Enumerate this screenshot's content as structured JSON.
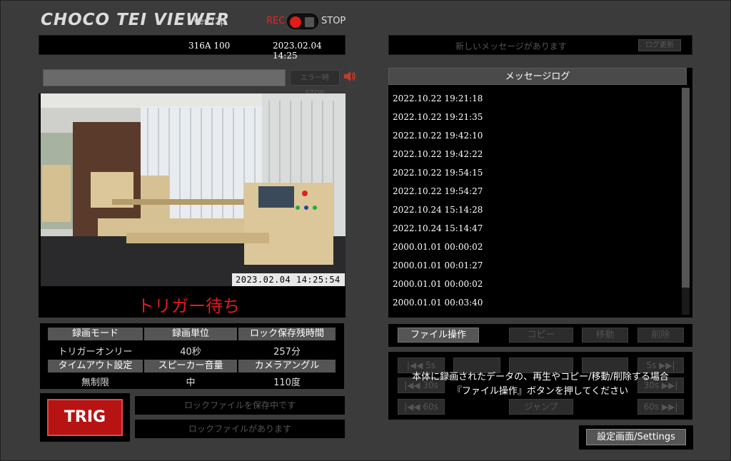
{
  "header": {
    "title": "CHOCO TEI VIEWER",
    "version": "Ver.72p",
    "rec_label": "REC",
    "stop_label": "STOP"
  },
  "infobar": {
    "code": "316A 100",
    "datetime": "2023.02.04 14:25"
  },
  "messagebar": {
    "new_message": "新しいメッセージがあります",
    "log_update_button": "ログ更新"
  },
  "camera": {
    "error_stop_button": "エラー時 STOP",
    "timestamp": "2023.02.04  14:25:54",
    "status_text": "トリガー待ち"
  },
  "message_log": {
    "header": "メッセージログ",
    "entries": [
      "2022.10.22 19:21:18",
      "2022.10.22 19:21:35",
      "2022.10.22 19:42:10",
      "2022.10.22 19:42:22",
      "2022.10.22 19:54:15",
      "2022.10.22 19:54:27",
      "2022.10.24 15:14:28",
      "2022.10.24 15:14:47",
      "2000.01.01 00:00:02",
      "2000.01.01 00:01:27",
      "2000.01.01 00:00:02",
      "2000.01.01 00:03:40"
    ]
  },
  "settings_status": {
    "labels": [
      "録画モード",
      "録画単位",
      "ロック保存残時間",
      "タイムアウト設定",
      "スピーカー音量",
      "カメラアングル"
    ],
    "values": [
      "トリガーオンリー",
      "40秒",
      "257分",
      "無制限",
      "中",
      "110度"
    ]
  },
  "trigger": {
    "button": "TRIG",
    "lock_saving": "ロックファイルを保存中です",
    "lock_exists": "ロックファイルがあります"
  },
  "file_ops": {
    "file_operation": "ファイル操作",
    "copy": "コピー",
    "move": "移動",
    "delete": "削除"
  },
  "playback": {
    "back_5s": "5s",
    "back_30s": "30s",
    "back_60s": "60s",
    "fwd_5s": "5s",
    "fwd_30s": "30s",
    "fwd_60s": "60s",
    "jump": "ジャンプ",
    "message_line1": "本体に録画されたデータの、再生やコピー/移動/削除する場合",
    "message_line2": "『ファイル操作』ボタンを押してください"
  },
  "settings_button": "設定画面/Settings",
  "colors": {
    "accent_red": "#e21b1b",
    "trig_red": "#b81313",
    "panel_bg": "#000000",
    "window_bg": "#3b3b3b"
  }
}
